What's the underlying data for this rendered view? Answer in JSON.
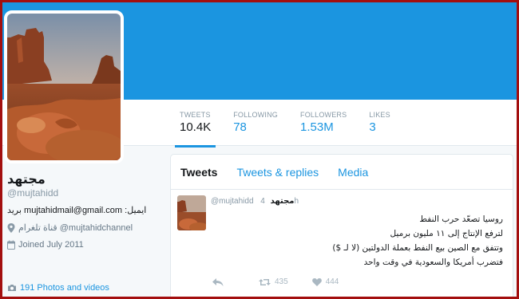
{
  "profile": {
    "display_name": "مجتهد",
    "handle": "@mujtahidd",
    "bio": "بريد mujtahidmail@gmail.com :ايميل",
    "location": "قناة تلغرام @mujtahidchannel",
    "joined": "Joined July 2011",
    "photos_link": "191 Photos and videos"
  },
  "stats": [
    {
      "label": "TWEETS",
      "value": "10.4K",
      "active": true
    },
    {
      "label": "FOLLOWING",
      "value": "78",
      "active": false
    },
    {
      "label": "FOLLOWERS",
      "value": "1.53M",
      "active": false
    },
    {
      "label": "LIKES",
      "value": "3",
      "active": false
    }
  ],
  "tabs": {
    "tweets": "Tweets",
    "tweets_replies": "Tweets & replies",
    "media": "Media"
  },
  "tweet": {
    "name": "مجتهد",
    "handle": "@mujtahidd",
    "time": "4h",
    "lines": [
      "روسيا تصعّد حرب النفط",
      "لترفع الإنتاج إلى ١١ مليون برميل",
      "وتتفق مع الصين بيع النفط بعملة الدولتين (لا لـ $)",
      "فتضرب أمريكا والسعودية في وقت واحد"
    ],
    "retweets": "435",
    "likes": "444"
  },
  "colors": {
    "brand": "#1b95e0",
    "frame": "#a30f0f"
  },
  "icons": [
    "location-pin-icon",
    "calendar-icon",
    "camera-icon",
    "reply-icon",
    "retweet-icon",
    "heart-icon"
  ]
}
